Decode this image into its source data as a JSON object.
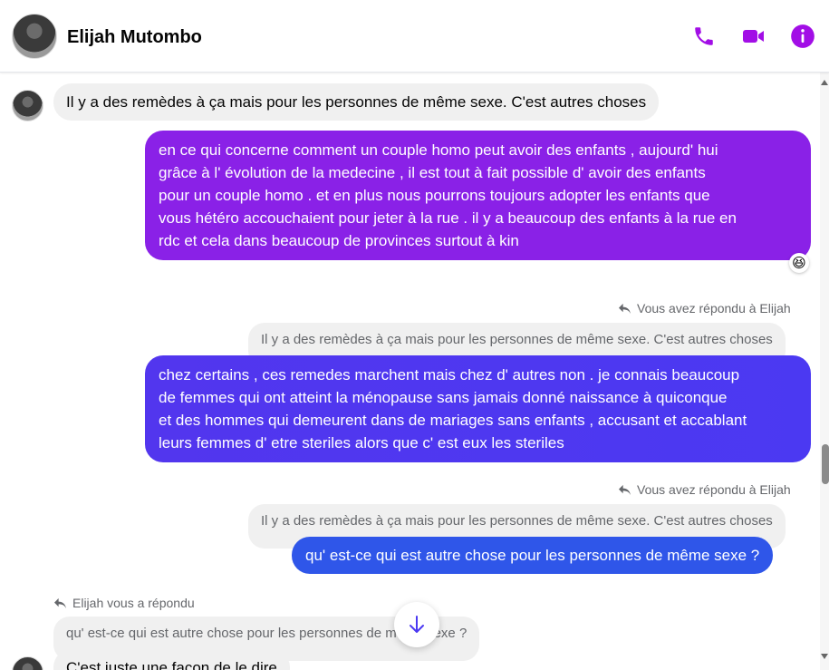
{
  "header": {
    "contact_name": "Elijah Mutombo",
    "icons": [
      "phone-icon",
      "video-camera-icon",
      "info-icon"
    ],
    "accent_color": "#a20ee6"
  },
  "messages": [
    {
      "direction": "in",
      "text": "Il y a des remèdes à ça mais pour les personnes de même sexe. C'est autres choses"
    },
    {
      "direction": "out",
      "lines": [
        "en ce qui concerne comment un couple homo peut avoir des enfants , aujourd' hui",
        "grâce à l' évolution de la medecine , il est tout à fait possible d' avoir des enfants",
        "pour un couple homo . et en plus nous pourrons toujours adopter les enfants que",
        "vous hétéro accouchaient pour jeter à la rue . il y a beaucoup des enfants à la rue en",
        "rdc et cela dans beaucoup de provinces surtout à kin"
      ],
      "reaction": "😆"
    },
    {
      "direction": "out",
      "reply_label": "Vous avez répondu à Elijah",
      "quoted": "Il y a des remèdes à ça mais pour les personnes de même sexe. C'est autres choses",
      "lines": [
        "chez certains , ces remedes marchent mais chez d' autres non . je connais beaucoup",
        "de femmes qui ont atteint la ménopause sans jamais donné naissance à quiconque",
        "et des hommes qui demeurent dans de mariages sans enfants , accusant et accablant",
        "leurs femmes d' etre steriles alors que c' est eux les steriles"
      ]
    },
    {
      "direction": "out",
      "reply_label": "Vous avez répondu à Elijah",
      "quoted": "Il y a des remèdes à ça mais pour les personnes de même sexe. C'est autres choses",
      "text": "qu' est-ce qui est autre chose pour les personnes de même sexe ?"
    },
    {
      "direction": "in",
      "reply_label": "Elijah vous a répondu",
      "quoted": "qu' est-ce qui est autre chose pour les personnes de même sexe ?",
      "text": "C'est juste une façon de le dire"
    }
  ],
  "colors": {
    "bubble_purple": "#8a21e7",
    "bubble_indigo": "#4b39f2",
    "bubble_blue": "#2f56e9",
    "bubble_incoming": "#f0f0f0"
  }
}
